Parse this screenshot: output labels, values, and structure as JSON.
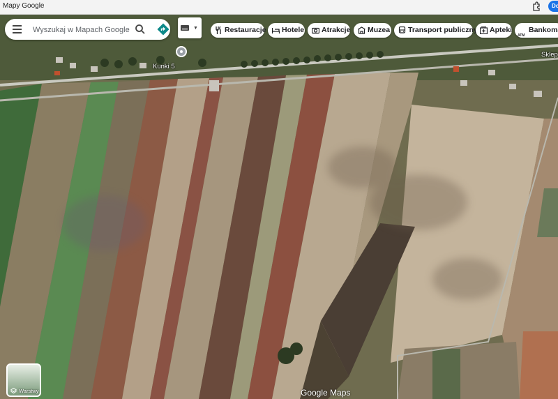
{
  "window": {
    "title": "Mapy Google",
    "profile_initial": "Do"
  },
  "search": {
    "placeholder": "Wyszukaj w Mapach Google"
  },
  "chips": [
    {
      "label": "Restauracje",
      "icon": "fork-knife-icon"
    },
    {
      "label": "Hotele",
      "icon": "bed-icon"
    },
    {
      "label": "Atrakcje",
      "icon": "camera-icon"
    },
    {
      "label": "Muzea",
      "icon": "museum-icon"
    },
    {
      "label": "Transport publiczny",
      "icon": "bus-icon"
    },
    {
      "label": "Apteki",
      "icon": "pharmacy-icon"
    },
    {
      "label": "Bankomaty",
      "icon": "atm-icon",
      "icon_text": "ATM"
    }
  ],
  "map": {
    "pin_label": "Kunki 5",
    "poi_label": "Sklep",
    "layers_label": "Warstwy",
    "logo": "Google Maps"
  },
  "colors": {
    "accent": "#1a73e8",
    "directions": "#0e8a8a"
  }
}
